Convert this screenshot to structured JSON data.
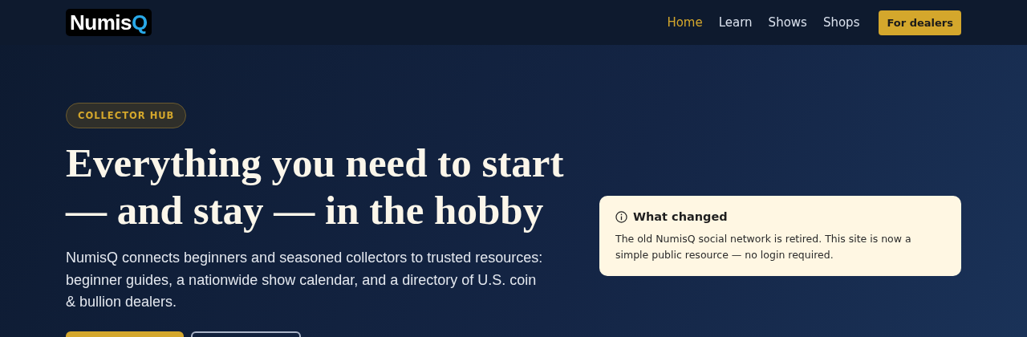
{
  "logo": {
    "text": "Numis",
    "accent": "Q"
  },
  "nav": [
    {
      "label": "Home",
      "selected": true
    },
    {
      "label": "Learn",
      "selected": false
    },
    {
      "label": "Shows",
      "selected": false
    },
    {
      "label": "Shops",
      "selected": false
    }
  ],
  "cta": "For dealers",
  "hero": {
    "badge": "COLLECTOR HUB",
    "heading_lines": [
      "Everything you need to start",
      "— and stay — in the hobby"
    ],
    "intro": "NumisQ connects beginners and seasoned collectors to trusted resources: beginner guides, a nationwide show calendar, and a directory of U.S. coin & bullion dealers.",
    "buttons": [
      {
        "kind": "primary"
      },
      {
        "kind": "secondary"
      }
    ]
  },
  "notice": {
    "title": "What changed",
    "body": "The old NumisQ social network is retired. This site is now a simple public resource — no login required."
  }
}
